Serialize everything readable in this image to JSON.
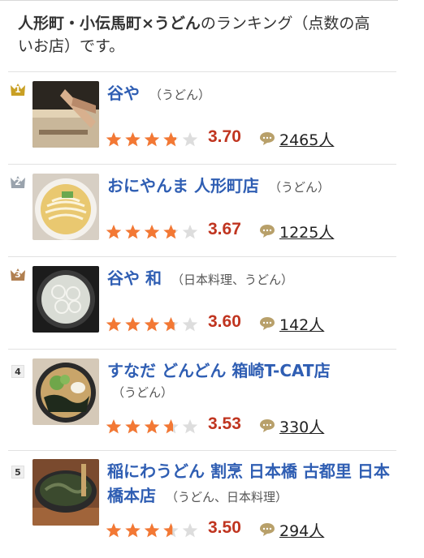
{
  "heading": {
    "bold": "人形町・小伝馬町×うどん",
    "rest": "のランキング（点数の高いお店）です。"
  },
  "colors": {
    "link": "#2f5eb3",
    "score": "#c03520",
    "star_filled": "#f37834",
    "star_empty": "#dddddd",
    "gold": "#c9a024",
    "silver": "#9aa3ad",
    "bronze": "#b07f50"
  },
  "restaurants": [
    {
      "rank": "1",
      "rank_style": "gold-crown",
      "name": "谷や",
      "genre": "（うどん）",
      "score": "3.70",
      "rating": 3.7,
      "reviews": "2465人",
      "thumbnail": "noodle-kneading-photo"
    },
    {
      "rank": "2",
      "rank_style": "silver-crown",
      "name": "おにやんま 人形町店",
      "genre": "（うどん）",
      "score": "3.67",
      "rating": 3.67,
      "reviews": "1225人",
      "thumbnail": "udon-bowl-photo"
    },
    {
      "rank": "3",
      "rank_style": "bronze-crown",
      "name": "谷や 和",
      "genre": "（日本料理、うどん）",
      "score": "3.60",
      "rating": 3.6,
      "reviews": "142人",
      "thumbnail": "clear-broth-udon-photo"
    },
    {
      "rank": "4",
      "rank_style": "number",
      "name": "すなだ どんどん 箱崎T-CAT店",
      "genre": "（うどん）",
      "score": "3.53",
      "rating": 3.53,
      "reviews": "330人",
      "thumbnail": "seaweed-udon-photo"
    },
    {
      "rank": "5",
      "rank_style": "number",
      "name": "稲にわうどん 割烹 日本橋 古都里 日本橋本店",
      "genre": "（うどん、日本料理）",
      "score": "3.50",
      "rating": 3.5,
      "reviews": "294人",
      "thumbnail": "nori-udon-photo"
    }
  ]
}
